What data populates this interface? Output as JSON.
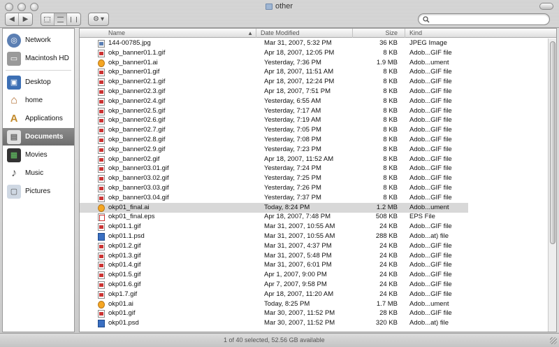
{
  "window": {
    "title": "other",
    "status": "1 of 40 selected, 52.56 GB available"
  },
  "toolbar": {
    "back_icon": "◀",
    "forward_icon": "▶",
    "action_icon": "⚙",
    "action_caret": "▾",
    "search_placeholder": ""
  },
  "sidebar": {
    "items": [
      {
        "label": "Network",
        "icon": "network-icon",
        "glyph": "◎",
        "color": "#5b7fb3"
      },
      {
        "label": "Macintosh HD",
        "icon": "hard-disk-icon",
        "glyph": "▭",
        "color": "#7c7c7c"
      },
      {
        "label": "Desktop",
        "icon": "desktop-icon",
        "glyph": "▣",
        "color": "#3c6fb4"
      },
      {
        "label": "home",
        "icon": "home-icon",
        "glyph": "⌂",
        "color": "#b06c2f"
      },
      {
        "label": "Applications",
        "icon": "applications-icon",
        "glyph": "A",
        "color": "#c28a2b"
      },
      {
        "label": "Documents",
        "icon": "documents-icon",
        "glyph": "▤",
        "color": "#e0e0e0"
      },
      {
        "label": "Movies",
        "icon": "movies-icon",
        "glyph": "▦",
        "color": "#333333"
      },
      {
        "label": "Music",
        "icon": "music-icon",
        "glyph": "♪",
        "color": "#555555"
      },
      {
        "label": "Pictures",
        "icon": "pictures-icon",
        "glyph": "▢",
        "color": "#555555"
      }
    ],
    "active": "Documents"
  },
  "columns": {
    "name": "Name",
    "date": "Date Modified",
    "size": "Size",
    "kind": "Kind",
    "sort_indicator": "▲"
  },
  "files": [
    {
      "name": "144-00785.jpg",
      "date": "Mar 31, 2007, 5:32 PM",
      "size": "36 KB",
      "kind": "JPEG Image",
      "type": "jpg"
    },
    {
      "name": "okp_banner01.1.gif",
      "date": "Apr 18, 2007, 12:05 PM",
      "size": "8 KB",
      "kind": "Adob...GIF file",
      "type": "gif"
    },
    {
      "name": "okp_banner01.ai",
      "date": "Yesterday, 7:36 PM",
      "size": "1.9 MB",
      "kind": "Adob...ument",
      "type": "ai"
    },
    {
      "name": "okp_banner01.gif",
      "date": "Apr 18, 2007, 11:51 AM",
      "size": "8 KB",
      "kind": "Adob...GIF file",
      "type": "gif"
    },
    {
      "name": "okp_banner02.1.gif",
      "date": "Apr 18, 2007, 12:24 PM",
      "size": "8 KB",
      "kind": "Adob...GIF file",
      "type": "gif"
    },
    {
      "name": "okp_banner02.3.gif",
      "date": "Apr 18, 2007, 7:51 PM",
      "size": "8 KB",
      "kind": "Adob...GIF file",
      "type": "gif"
    },
    {
      "name": "okp_banner02.4.gif",
      "date": "Yesterday, 6:55 AM",
      "size": "8 KB",
      "kind": "Adob...GIF file",
      "type": "gif"
    },
    {
      "name": "okp_banner02.5.gif",
      "date": "Yesterday, 7:17 AM",
      "size": "8 KB",
      "kind": "Adob...GIF file",
      "type": "gif"
    },
    {
      "name": "okp_banner02.6.gif",
      "date": "Yesterday, 7:19 AM",
      "size": "8 KB",
      "kind": "Adob...GIF file",
      "type": "gif"
    },
    {
      "name": "okp_banner02.7.gif",
      "date": "Yesterday, 7:05 PM",
      "size": "8 KB",
      "kind": "Adob...GIF file",
      "type": "gif"
    },
    {
      "name": "okp_banner02.8.gif",
      "date": "Yesterday, 7:08 PM",
      "size": "8 KB",
      "kind": "Adob...GIF file",
      "type": "gif"
    },
    {
      "name": "okp_banner02.9.gif",
      "date": "Yesterday, 7:23 PM",
      "size": "8 KB",
      "kind": "Adob...GIF file",
      "type": "gif"
    },
    {
      "name": "okp_banner02.gif",
      "date": "Apr 18, 2007, 11:52 AM",
      "size": "8 KB",
      "kind": "Adob...GIF file",
      "type": "gif"
    },
    {
      "name": "okp_banner03.01.gif",
      "date": "Yesterday, 7:24 PM",
      "size": "8 KB",
      "kind": "Adob...GIF file",
      "type": "gif"
    },
    {
      "name": "okp_banner03.02.gif",
      "date": "Yesterday, 7:25 PM",
      "size": "8 KB",
      "kind": "Adob...GIF file",
      "type": "gif"
    },
    {
      "name": "okp_banner03.03.gif",
      "date": "Yesterday, 7:26 PM",
      "size": "8 KB",
      "kind": "Adob...GIF file",
      "type": "gif"
    },
    {
      "name": "okp_banner03.04.gif",
      "date": "Yesterday, 7:37 PM",
      "size": "8 KB",
      "kind": "Adob...GIF file",
      "type": "gif"
    },
    {
      "name": "okp01_final.ai",
      "date": "Today, 8:24 PM",
      "size": "1.2 MB",
      "kind": "Adob...ument",
      "type": "ai",
      "selected": true
    },
    {
      "name": "okp01_final.eps",
      "date": "Apr 18, 2007, 7:48 PM",
      "size": "508 KB",
      "kind": "EPS File",
      "type": "eps"
    },
    {
      "name": "okp01.1.gif",
      "date": "Mar 31, 2007, 10:55 AM",
      "size": "24 KB",
      "kind": "Adob...GIF file",
      "type": "gif"
    },
    {
      "name": "okp01.1.psd",
      "date": "Mar 31, 2007, 10:55 AM",
      "size": "288 KB",
      "kind": "Adob...at) file",
      "type": "psd"
    },
    {
      "name": "okp01.2.gif",
      "date": "Mar 31, 2007, 4:37 PM",
      "size": "24 KB",
      "kind": "Adob...GIF file",
      "type": "gif"
    },
    {
      "name": "okp01.3.gif",
      "date": "Mar 31, 2007, 5:48 PM",
      "size": "24 KB",
      "kind": "Adob...GIF file",
      "type": "gif"
    },
    {
      "name": "okp01.4.gif",
      "date": "Mar 31, 2007, 6:01 PM",
      "size": "24 KB",
      "kind": "Adob...GIF file",
      "type": "gif"
    },
    {
      "name": "okp01.5.gif",
      "date": "Apr 1, 2007, 9:00 PM",
      "size": "24 KB",
      "kind": "Adob...GIF file",
      "type": "gif"
    },
    {
      "name": "okp01.6.gif",
      "date": "Apr 7, 2007, 9:58 PM",
      "size": "24 KB",
      "kind": "Adob...GIF file",
      "type": "gif"
    },
    {
      "name": "okp1.7.gif",
      "date": "Apr 18, 2007, 11:20 AM",
      "size": "24 KB",
      "kind": "Adob...GIF file",
      "type": "gif"
    },
    {
      "name": "okp01.ai",
      "date": "Today, 8:25 PM",
      "size": "1.7 MB",
      "kind": "Adob...ument",
      "type": "ai"
    },
    {
      "name": "okp01.gif",
      "date": "Mar 30, 2007, 11:52 PM",
      "size": "28 KB",
      "kind": "Adob...GIF file",
      "type": "gif"
    },
    {
      "name": "okp01.psd",
      "date": "Mar 30, 2007, 11:52 PM",
      "size": "320 KB",
      "kind": "Adob...at) file",
      "type": "psd"
    }
  ]
}
